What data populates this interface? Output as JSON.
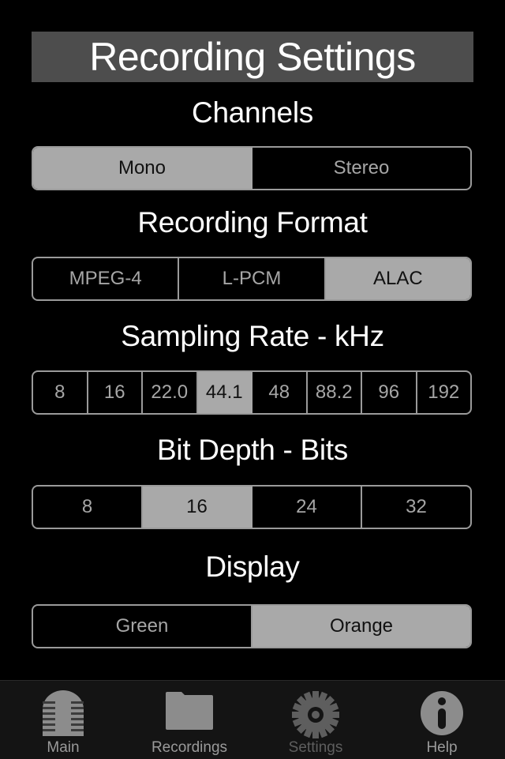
{
  "header": {
    "title": "Recording Settings"
  },
  "channels": {
    "label": "Channels",
    "options": [
      "Mono",
      "Stereo"
    ],
    "selected": "Mono"
  },
  "format": {
    "label": "Recording Format",
    "options": [
      "MPEG-4",
      "L-PCM",
      "ALAC"
    ],
    "selected": "ALAC"
  },
  "sampling_rate": {
    "label": "Sampling Rate - kHz",
    "options": [
      "8",
      "16",
      "22.0",
      "44.1",
      "48",
      "88.2",
      "96",
      "192"
    ],
    "selected": "44.1"
  },
  "bit_depth": {
    "label": "Bit Depth - Bits",
    "options": [
      "8",
      "16",
      "24",
      "32"
    ],
    "selected": "16"
  },
  "display": {
    "label": "Display",
    "options": [
      "Green",
      "Orange"
    ],
    "selected": "Orange"
  },
  "tabbar": {
    "items": [
      {
        "label": "Main",
        "icon": "microphone-icon"
      },
      {
        "label": "Recordings",
        "icon": "folder-icon"
      },
      {
        "label": "Settings",
        "icon": "gear-icon",
        "active": true
      },
      {
        "label": "Help",
        "icon": "info-icon"
      }
    ]
  },
  "colors": {
    "background": "#000000",
    "title_bar": "#4d4d4d",
    "selected_segment": "#a9a9a9",
    "segment_border": "#9a9a9a",
    "tab_icon": "#8c8c8c",
    "tab_icon_active": "#5e5e5e"
  }
}
